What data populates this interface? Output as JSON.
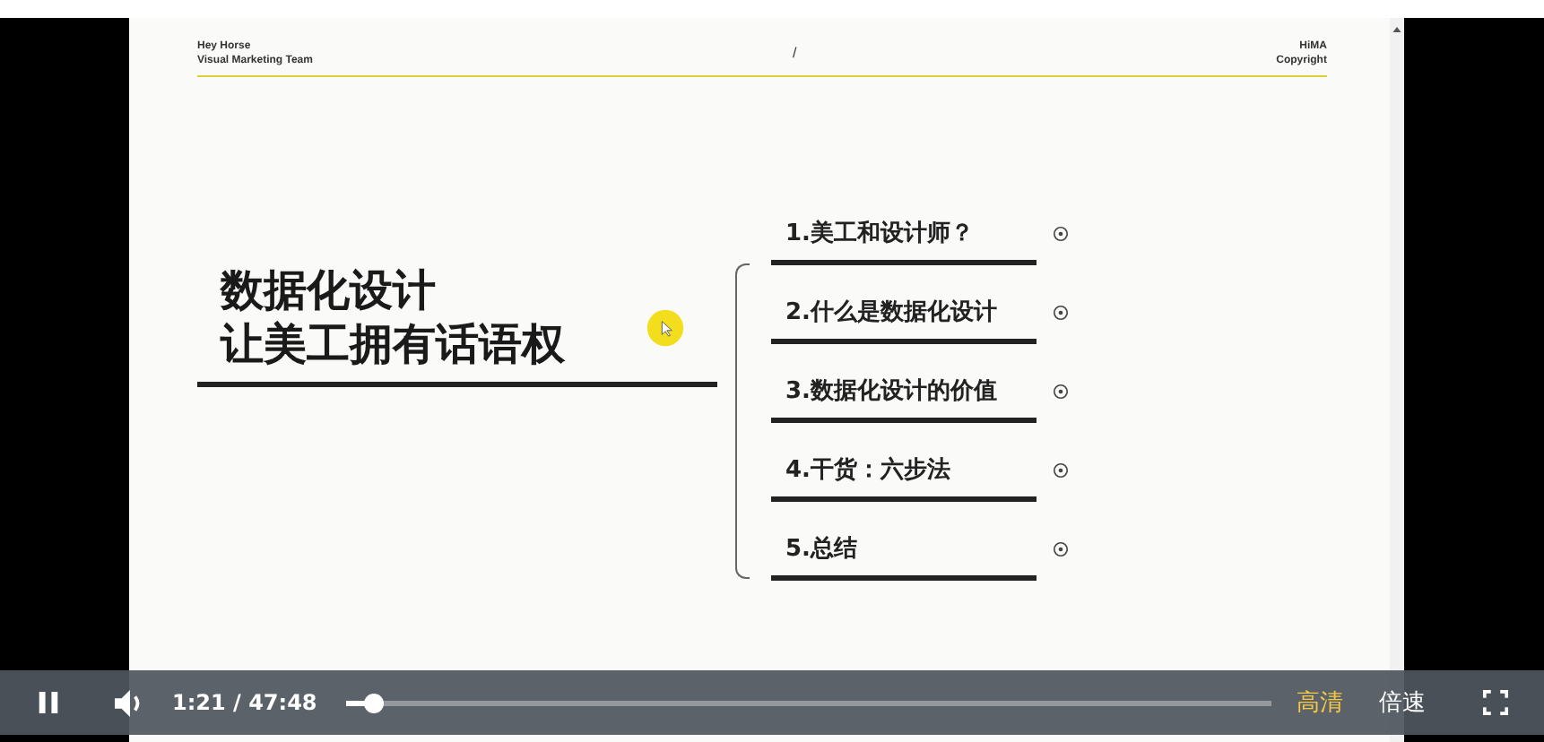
{
  "slide": {
    "header_left": [
      "Hey Horse",
      "Visual Marketing Team"
    ],
    "header_center": "/",
    "header_right": [
      "HiMA",
      "Copyright"
    ],
    "title_lines": [
      "数据化设计",
      "让美工拥有话语权"
    ],
    "outline": [
      {
        "label": "1.美工和设计师？"
      },
      {
        "label": "2.什么是数据化设计"
      },
      {
        "label": "3.数据化设计的价值"
      },
      {
        "label": "4.干货：六步法"
      },
      {
        "label": "5.总结"
      }
    ]
  },
  "player": {
    "playing": true,
    "time": "1:21 / 47:48",
    "progress": {
      "level": 0.03
    },
    "quality": "高清",
    "speed": "倍速"
  }
}
